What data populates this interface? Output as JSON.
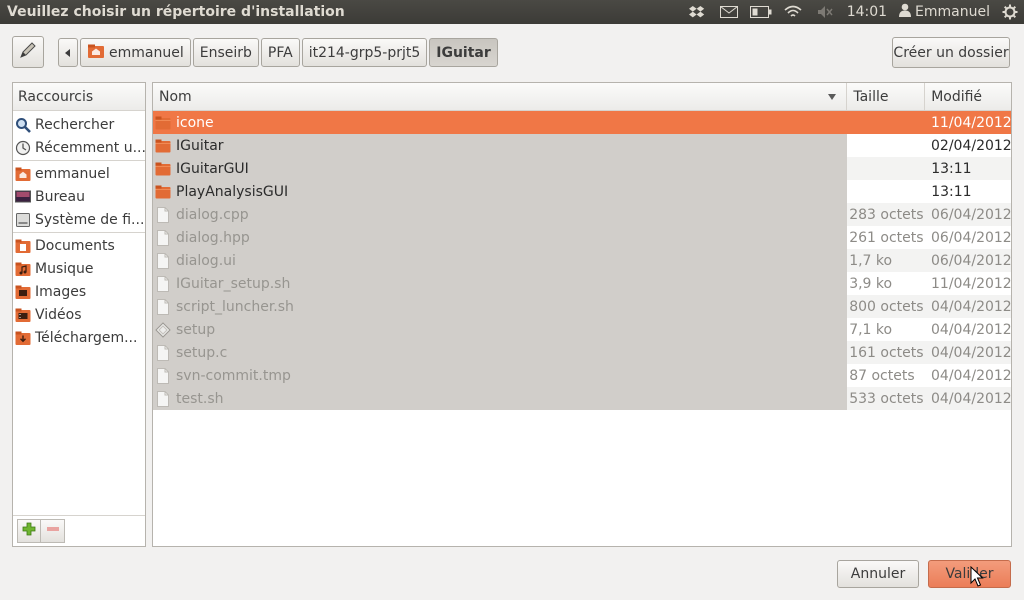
{
  "window": {
    "title": "Veuillez choisir un répertoire d'installation"
  },
  "panel": {
    "clock": "14:01",
    "user": "Emmanuel",
    "icons": [
      "dropbox-icon",
      "mail-icon",
      "battery-icon",
      "wifi-icon",
      "volume-muted-icon",
      "power-icon"
    ]
  },
  "pathbar": {
    "segments": [
      "emmanuel",
      "Enseirb",
      "PFA",
      "it214-grp5-prjt5",
      "IGuitar"
    ],
    "active_index": 4
  },
  "toolbar": {
    "create_folder": "Créer un dossier"
  },
  "sidebar": {
    "header": "Raccourcis",
    "items": [
      {
        "label": "Rechercher",
        "icon": "search-icon"
      },
      {
        "label": "Récemment u...",
        "icon": "recent-icon"
      },
      {
        "label": "emmanuel",
        "icon": "home-folder-icon"
      },
      {
        "label": "Bureau",
        "icon": "desktop-icon"
      },
      {
        "label": "Système de fi...",
        "icon": "filesystem-icon"
      },
      {
        "label": "Documents",
        "icon": "documents-folder-icon"
      },
      {
        "label": "Musique",
        "icon": "music-folder-icon"
      },
      {
        "label": "Images",
        "icon": "pictures-folder-icon"
      },
      {
        "label": "Vidéos",
        "icon": "videos-folder-icon"
      },
      {
        "label": "Téléchargem...",
        "icon": "downloads-folder-icon"
      }
    ]
  },
  "files": {
    "columns": {
      "name": "Nom",
      "size": "Taille",
      "modified": "Modifié"
    },
    "rows": [
      {
        "name": "icone",
        "size": "",
        "modified": "11/04/2012",
        "type": "folder",
        "selected": true
      },
      {
        "name": "IGuitar",
        "size": "",
        "modified": "02/04/2012",
        "type": "folder"
      },
      {
        "name": "IGuitarGUI",
        "size": "",
        "modified": "13:11",
        "type": "folder"
      },
      {
        "name": "PlayAnalysisGUI",
        "size": "",
        "modified": "13:11",
        "type": "folder"
      },
      {
        "name": "dialog.cpp",
        "size": "283 octets",
        "modified": "06/04/2012",
        "type": "file"
      },
      {
        "name": "dialog.hpp",
        "size": "261 octets",
        "modified": "06/04/2012",
        "type": "file"
      },
      {
        "name": "dialog.ui",
        "size": "1,7 ko",
        "modified": "06/04/2012",
        "type": "file"
      },
      {
        "name": "IGuitar_setup.sh",
        "size": "3,9 ko",
        "modified": "11/04/2012",
        "type": "file"
      },
      {
        "name": "script_luncher.sh",
        "size": "800 octets",
        "modified": "04/04/2012",
        "type": "file"
      },
      {
        "name": "setup",
        "size": "7,1 ko",
        "modified": "04/04/2012",
        "type": "exec"
      },
      {
        "name": "setup.c",
        "size": "161 octets",
        "modified": "04/04/2012",
        "type": "file"
      },
      {
        "name": "svn-commit.tmp",
        "size": "87 octets",
        "modified": "04/04/2012",
        "type": "file"
      },
      {
        "name": "test.sh",
        "size": "533 octets",
        "modified": "04/04/2012",
        "type": "file"
      }
    ]
  },
  "actions": {
    "cancel": "Annuler",
    "ok": "Valider"
  }
}
